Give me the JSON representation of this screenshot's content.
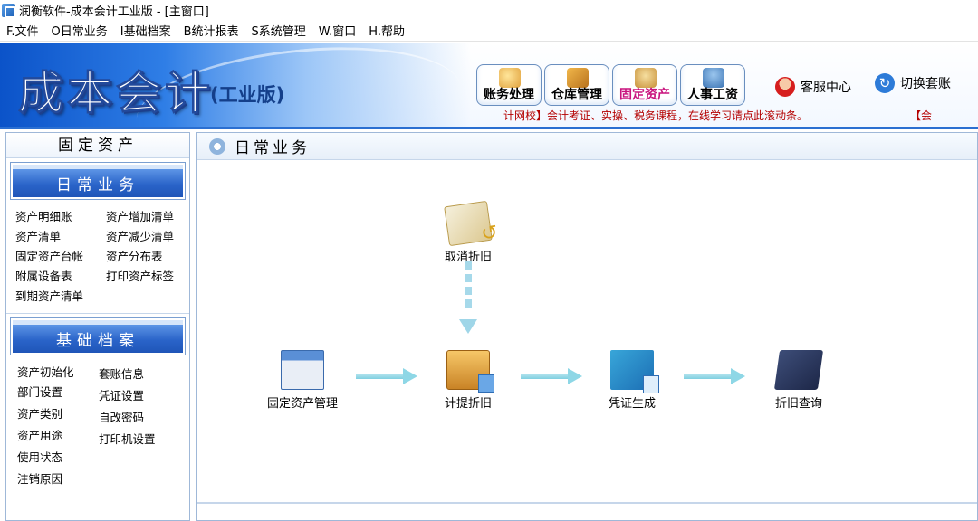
{
  "window": {
    "title": "润衡软件-成本会计工业版 - [主窗口]",
    "icon": "app-icon"
  },
  "menu": [
    {
      "label": "F.文件"
    },
    {
      "label": "O日常业务"
    },
    {
      "label": "I基础档案"
    },
    {
      "label": "B统计报表"
    },
    {
      "label": "S系统管理"
    },
    {
      "label": "W.窗口"
    },
    {
      "label": "H.帮助"
    }
  ],
  "header": {
    "logo": "成本会计",
    "edition": "(工业版)",
    "modules": [
      {
        "label": "账务处理",
        "icon": "ledger-icon"
      },
      {
        "label": "仓库管理",
        "icon": "warehouse-box-icon"
      },
      {
        "label": "固定资产",
        "icon": "fixed-assets-icon",
        "active": true
      },
      {
        "label": "人事工资",
        "icon": "hr-people-icon"
      }
    ],
    "service": {
      "label": "客服中心",
      "icon": "customer-service-icon"
    },
    "switch": {
      "label": "切换套账",
      "icon": "refresh-icon"
    },
    "ticker": "计网校】会计考证、实操、税务课程，在线学习请点此滚动条。",
    "ticker_more": "【会"
  },
  "sidebar": {
    "title": "固定资产",
    "daily": {
      "title": "日常业务",
      "links": [
        "资产明细账",
        "资产增加清单",
        "资产清单",
        "资产减少清单",
        "固定资产台帐",
        "资产分布表",
        "附属设备表",
        "打印资产标签",
        "到期资产清单"
      ]
    },
    "basic": {
      "title": "基础档案",
      "links": [
        "资产初始化",
        "套账信息",
        "部门设置",
        "凭证设置",
        "资产类别",
        "自改密码",
        "资产用途",
        "打印机设置",
        "使用状态",
        "注销原因"
      ]
    }
  },
  "main": {
    "title": "日常业务",
    "nodes": {
      "cancel": "取消折旧",
      "asset": "固定资产管理",
      "depr": "计提折旧",
      "voucher": "凭证生成",
      "query": "折旧查询"
    }
  },
  "colors": {
    "brand_blue": "#2b6fd1",
    "active_module": "#c8127d",
    "ticker_red": "#b40000"
  }
}
